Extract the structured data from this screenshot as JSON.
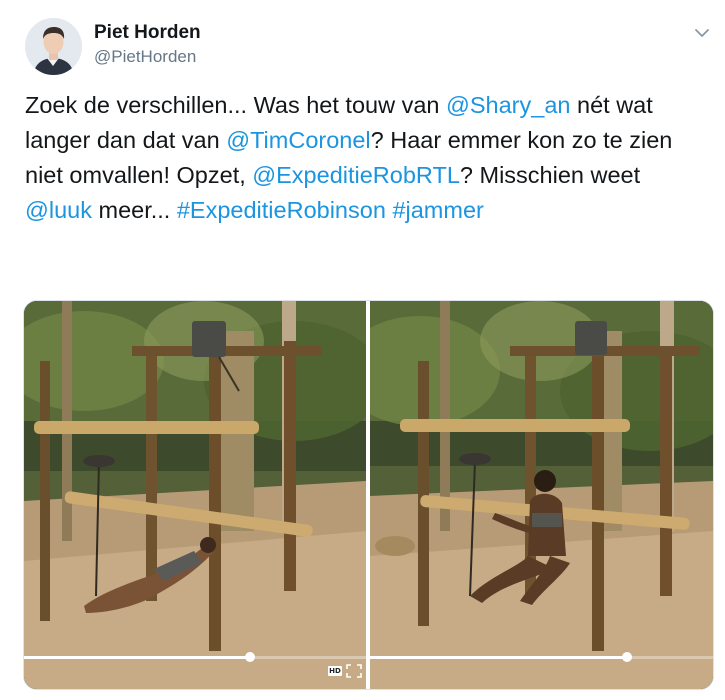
{
  "author": {
    "name": "Piet Horden",
    "handle": "@PietHorden",
    "avatar_icon": "person-avatar"
  },
  "menu": {
    "icon": "chevron-down-icon"
  },
  "tweet": {
    "segments": [
      {
        "text": "Zoek de verschillen... Was het touw van ",
        "type": "text"
      },
      {
        "text": "@Shary_an",
        "type": "mention"
      },
      {
        "text": " nét wat langer dan dat van ",
        "type": "text"
      },
      {
        "text": "@TimCoronel",
        "type": "mention"
      },
      {
        "text": "? Haar emmer kon zo te zien niet omvallen! Opzet, ",
        "type": "text"
      },
      {
        "text": "@ExpeditieRobRTL",
        "type": "mention"
      },
      {
        "text": "? Misschien weet ",
        "type": "text"
      },
      {
        "text": "@luuk",
        "type": "mention"
      },
      {
        "text": " meer... ",
        "type": "text"
      },
      {
        "text": "#ExpeditieRobinson",
        "type": "hashtag"
      },
      {
        "text": " ",
        "type": "text"
      },
      {
        "text": "#jammer",
        "type": "hashtag"
      }
    ]
  },
  "media": {
    "left_video": {
      "progress_fraction": 0.66,
      "controls": {
        "hd_label": "HD",
        "fullscreen_icon": "fullscreen-icon"
      }
    },
    "right_video": {
      "progress_fraction": 0.75
    }
  },
  "colors": {
    "link": "#1b95e0",
    "text": "#14171a",
    "secondary": "#657786"
  }
}
